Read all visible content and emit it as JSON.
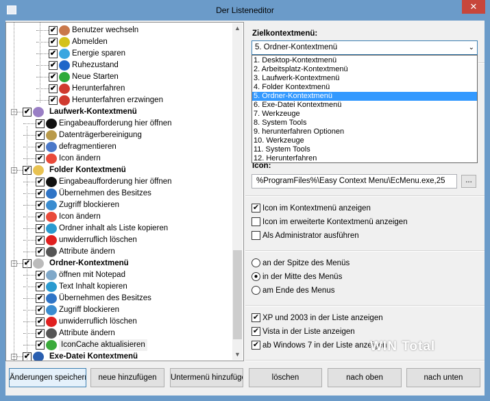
{
  "window": {
    "title": "Der Listeneditor",
    "close_label": "✕"
  },
  "tree": {
    "rows": [
      {
        "level": 2,
        "label": "Benutzer wechseln",
        "icon": "users-icon",
        "color": "#c9784b"
      },
      {
        "level": 2,
        "label": "Abmelden",
        "icon": "power-yellow-icon",
        "color": "#d4c21b"
      },
      {
        "level": 2,
        "label": "Energie sparen",
        "icon": "sleep-icon",
        "color": "#3aa6e0"
      },
      {
        "level": 2,
        "label": "Ruhezustand",
        "icon": "power-blue-icon",
        "color": "#1f66c9"
      },
      {
        "level": 2,
        "label": "Neue Starten",
        "icon": "power-green-icon",
        "color": "#2eaa3a"
      },
      {
        "level": 2,
        "label": "Herunterfahren",
        "icon": "power-red-icon",
        "color": "#d03a30"
      },
      {
        "level": 2,
        "label": "Herunterfahren erzwingen",
        "icon": "power-red-icon",
        "color": "#d03a30"
      },
      {
        "level": 0,
        "label": "Laufwerk-Kontextmenü",
        "icon": "drive-icon",
        "color": "#9a7fc5"
      },
      {
        "level": 1,
        "label": "Eingabeaufforderung hier öffnen",
        "icon": "cmd-icon",
        "color": "#111111"
      },
      {
        "level": 1,
        "label": "Datenträgerbereinigung",
        "icon": "disk-cleanup-icon",
        "color": "#b99a4a"
      },
      {
        "level": 1,
        "label": "defragmentieren",
        "icon": "defrag-icon",
        "color": "#4a78c9"
      },
      {
        "level": 1,
        "label": "Icon ändern",
        "icon": "change-icon-icon",
        "color": "#e94a3a"
      },
      {
        "level": 0,
        "label": "Folder Kontextmenü",
        "icon": "folder-icon",
        "color": "#e8c252"
      },
      {
        "level": 1,
        "label": "Eingabeaufforderung hier öffnen",
        "icon": "cmd-icon",
        "color": "#111111"
      },
      {
        "level": 1,
        "label": "Übernehmen des Besitzes",
        "icon": "shield-icon",
        "color": "#2f74c6"
      },
      {
        "level": 1,
        "label": "Zugriff blockieren",
        "icon": "lock-icon",
        "color": "#3a8cd0"
      },
      {
        "level": 1,
        "label": "Icon ändern",
        "icon": "change-icon-icon",
        "color": "#e94a3a"
      },
      {
        "level": 1,
        "label": "Ordner inhalt als Liste kopieren",
        "icon": "copy-list-icon",
        "color": "#2a9ad0"
      },
      {
        "level": 1,
        "label": "unwiderruflich löschen",
        "icon": "delete-icon",
        "color": "#e02020"
      },
      {
        "level": 1,
        "label": "Attribute ändern",
        "icon": "attributes-icon",
        "color": "#555555"
      },
      {
        "level": 0,
        "label": "Ordner-Kontextmenü",
        "icon": "folders-icon",
        "color": "#bbbbbb"
      },
      {
        "level": 1,
        "label": "öffnen mit Notepad",
        "icon": "notepad-icon",
        "color": "#7fa8c9"
      },
      {
        "level": 1,
        "label": "Text Inhalt kopieren",
        "icon": "copy-list-icon",
        "color": "#2a9ad0"
      },
      {
        "level": 1,
        "label": "Übernehmen des Besitzes",
        "icon": "shield-icon",
        "color": "#2f74c6"
      },
      {
        "level": 1,
        "label": "Zugriff blockieren",
        "icon": "lock-icon",
        "color": "#3a8cd0"
      },
      {
        "level": 1,
        "label": "unwiderruflich löschen",
        "icon": "delete-icon",
        "color": "#e02020"
      },
      {
        "level": 1,
        "label": "Attribute ändern",
        "icon": "attributes-icon",
        "color": "#555555"
      },
      {
        "level": 1,
        "label": "IconCache aktualisieren",
        "icon": "refresh-icon",
        "color": "#3aaa3a",
        "hover": true
      },
      {
        "level": 0,
        "label": "Exe-Datei Kontextmenü",
        "icon": "window-icon",
        "color": "#2a5fb0"
      }
    ]
  },
  "target": {
    "label": "Zielkontextmenü:",
    "selected": "5. Ordner-Kontextmenü",
    "options": [
      "1. Desktop-Kontextmenü",
      "2. Arbeitsplatz-Kontextmenü",
      "3. Laufwerk-Kontextmenü",
      "4. Folder Kontextmenü",
      "5. Ordner-Kontextmenü",
      "6. Exe-Datei Kontextmenü",
      "7. Werkzeuge",
      "8. System Tools",
      "9. herunterfahren Optionen",
      "10. Werkzeuge",
      "11. System Tools",
      "12. Herunterfahren"
    ],
    "selected_index": 4
  },
  "icon": {
    "label": "Icon:",
    "value": "%ProgramFiles%\\Easy Context Menu\\EcMenu.exe,25",
    "browse_label": "..."
  },
  "options": [
    {
      "label": "Icon im Kontextmenü anzeigen",
      "checked": true
    },
    {
      "label": "Icon im erweiterte Kontextmenü anzeigen",
      "checked": false
    },
    {
      "label": "Als Administrator ausführen",
      "checked": false
    }
  ],
  "position": [
    {
      "label": "an der Spitze des Menüs",
      "selected": false
    },
    {
      "label": "in der Mitte des Menüs",
      "selected": true
    },
    {
      "label": "am Ende des Menus",
      "selected": false
    }
  ],
  "os": [
    {
      "label": "XP und 2003 in der Liste anzeigen",
      "checked": true
    },
    {
      "label": "Vista in der Liste anzeigen",
      "checked": true
    },
    {
      "label": "ab Windows 7 in der Liste anzeigen",
      "checked": true
    }
  ],
  "buttons": [
    "Änderungen speichern",
    "neue hinzufügen",
    "Untermenü hinzufügen",
    "löschen",
    "nach oben",
    "nach unten"
  ],
  "watermark": "WIN Total"
}
